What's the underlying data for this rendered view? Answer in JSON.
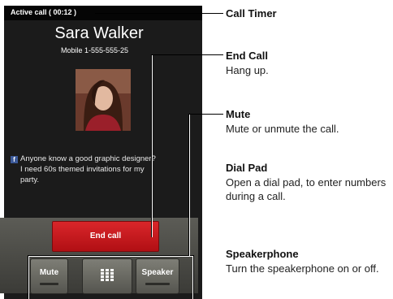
{
  "status_bar": {
    "timer": "Active call ( 00:12 )"
  },
  "contact": {
    "name": "Sara Walker",
    "number": "Mobile 1-555-555-25"
  },
  "status_message": {
    "icon": "f",
    "line1": "Anyone know a good graphic designer?",
    "line2": "I need 60s themed invitations for my",
    "line3": "party."
  },
  "buttons": {
    "end_call": "End call",
    "mute": "Mute",
    "speaker": "Speaker",
    "dialpad_icon": "dialpad-grid"
  },
  "callouts": [
    {
      "title": "Call Timer",
      "desc": ""
    },
    {
      "title": "End Call",
      "desc": "Hang up."
    },
    {
      "title": "Mute",
      "desc": "Mute or unmute the call."
    },
    {
      "title": "Dial Pad",
      "desc": "Open a dial pad, to enter numbers during a call."
    },
    {
      "title": "Speakerphone",
      "desc": "Turn the speakerphone on or off."
    }
  ],
  "colors": {
    "end_call": "#c4161c",
    "facebook": "#3b5998",
    "screen_bg": "#1b1b1b"
  }
}
